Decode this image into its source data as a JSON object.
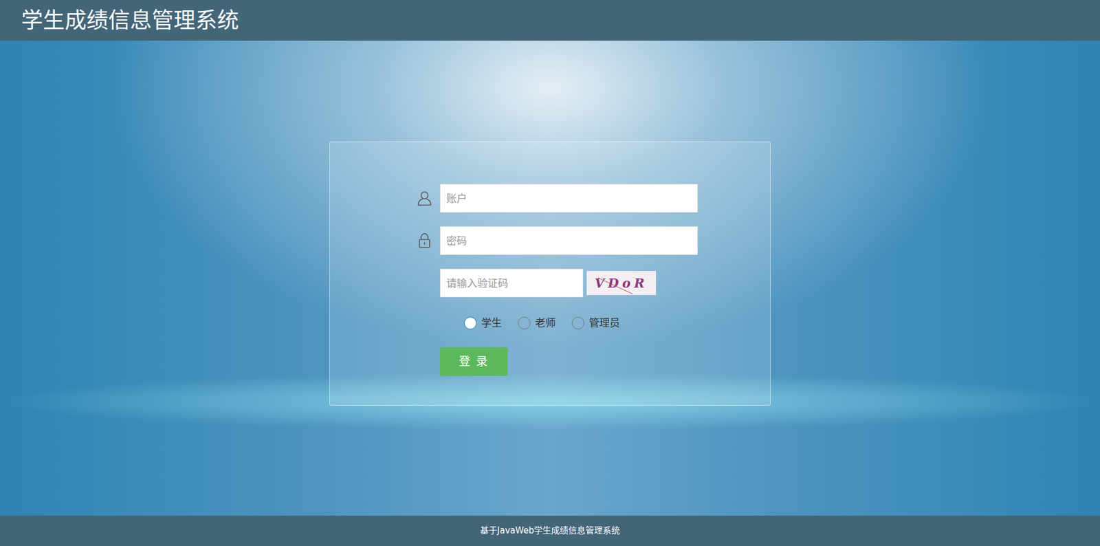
{
  "header": {
    "title": "学生成绩信息管理系统"
  },
  "form": {
    "account": {
      "placeholder": "账户"
    },
    "password": {
      "placeholder": "密码"
    },
    "captcha": {
      "placeholder": "请输入验证码",
      "code": "VDoR"
    },
    "roles": [
      {
        "label": "学生",
        "selected": true
      },
      {
        "label": "老师",
        "selected": false
      },
      {
        "label": "管理员",
        "selected": false
      }
    ],
    "submit": "登 录"
  },
  "footer": {
    "text": "基于JavaWeb学生成绩信息管理系统"
  }
}
